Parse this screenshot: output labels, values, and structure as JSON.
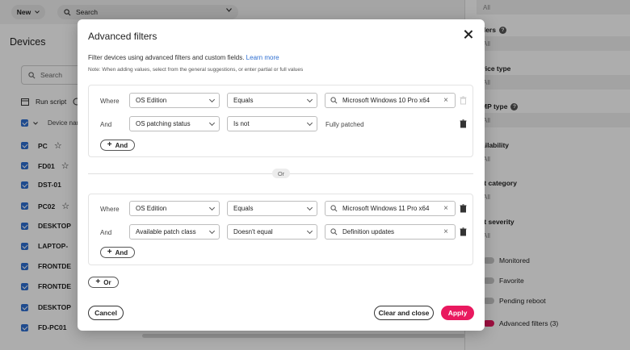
{
  "background": {
    "new_label": "New",
    "search_placeholder": "Search",
    "page_title": "Devices",
    "list_search_placeholder": "Search",
    "run_script_label": "Run script",
    "column_header": "Device nan",
    "rows": [
      "PC",
      "FD01",
      "DST-01",
      "PC02",
      "DESKTOP",
      "LAPTOP-",
      "FRONTDE",
      "FRONTDE",
      "DESKTOP",
      "FD-PC01"
    ]
  },
  "right_panel": {
    "top_value": "All",
    "orders_label": "ders",
    "orders_value": "All",
    "device_type_label": "vice type",
    "device_type_value": "All",
    "mp_type_label": "MP type",
    "mp_type_value": "All",
    "availability_label": "ailability",
    "availability_value": "All",
    "alert_category_label": "rt category",
    "alert_category_value": "All",
    "alert_severity_label": "rt severity",
    "alert_severity_value": "All",
    "monitored_label": "Monitored",
    "favorite_label": "Favorite",
    "pending_reboot_label": "Pending reboot",
    "advanced_filters_label": "Advanced filters (3)"
  },
  "modal": {
    "title": "Advanced filters",
    "description": "Filter devices using advanced filters and custom fields.",
    "learn_more": "Learn more",
    "note": "Note: When adding values, select from the general suggestions, or enter partial or full values",
    "groups": [
      {
        "rows": [
          {
            "label": "Where",
            "field": "OS Edition",
            "operator": "Equals",
            "value": "Microsoft Windows 10 Pro  x64"
          },
          {
            "label": "And",
            "field": "OS patching status",
            "operator": "Is not",
            "value": "Fully patched"
          }
        ],
        "and_label": "And"
      },
      {
        "rows": [
          {
            "label": "Where",
            "field": "OS Edition",
            "operator": "Equals",
            "value": "Microsoft Windows 11 Pro  x64"
          },
          {
            "label": "And",
            "field": "Available patch class",
            "operator": "Doesn't equal",
            "value": "Definition updates"
          }
        ],
        "and_label": "And"
      }
    ],
    "or_divider": "Or",
    "or_button": "Or",
    "cancel": "Cancel",
    "clear_and_close": "Clear and close",
    "apply": "Apply"
  },
  "colors": {
    "accent": "#e9195f",
    "link": "#2f6fd1",
    "checkbox": "#2f6fd1"
  }
}
